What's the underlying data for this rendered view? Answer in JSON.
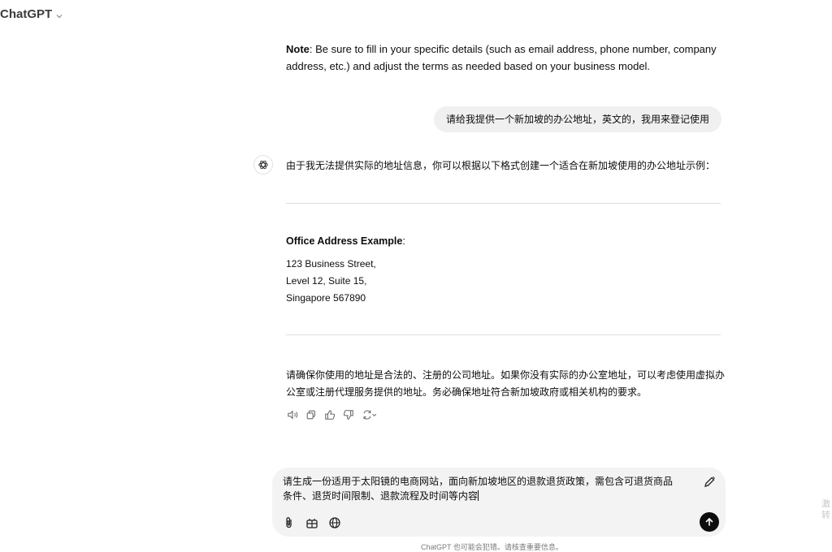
{
  "header": {
    "title": "ChatGPT"
  },
  "note": {
    "label": "Note",
    "text": ": Be sure to fill in your specific details (such as email address, phone number, company address, etc.) and adjust the terms as needed based on your business model."
  },
  "user_message": "请给我提供一个新加坡的办公地址，英文的，我用来登记使用",
  "assistant": {
    "intro": "由于我无法提供实际的地址信息，你可以根据以下格式创建一个适合在新加坡使用的办公地址示例：",
    "address_title": "Office Address Example",
    "address_title_suffix": ":",
    "address_lines": [
      "123 Business Street,",
      "Level 12, Suite 15,",
      "Singapore 567890"
    ],
    "closing": "请确保你使用的地址是合法的、注册的公司地址。如果你没有实际的办公室地址，可以考虑使用虚拟办公室或注册代理服务提供的地址。务必确保地址符合新加坡政府或相关机构的要求。"
  },
  "composer": {
    "text": "请生成一份适用于太阳镜的电商网站，面向新加坡地区的退款退货政策，需包含可退货商品条件、退货时间限制、退款流程及时间等内容"
  },
  "footer": {
    "text": "ChatGPT 也可能会犯错。请核查重要信息。"
  },
  "side_marks": [
    "激",
    "转"
  ],
  "colors": {
    "bubble": "#f0f0f0",
    "composer": "#f3f3f3",
    "send": "#0d0d0d"
  }
}
